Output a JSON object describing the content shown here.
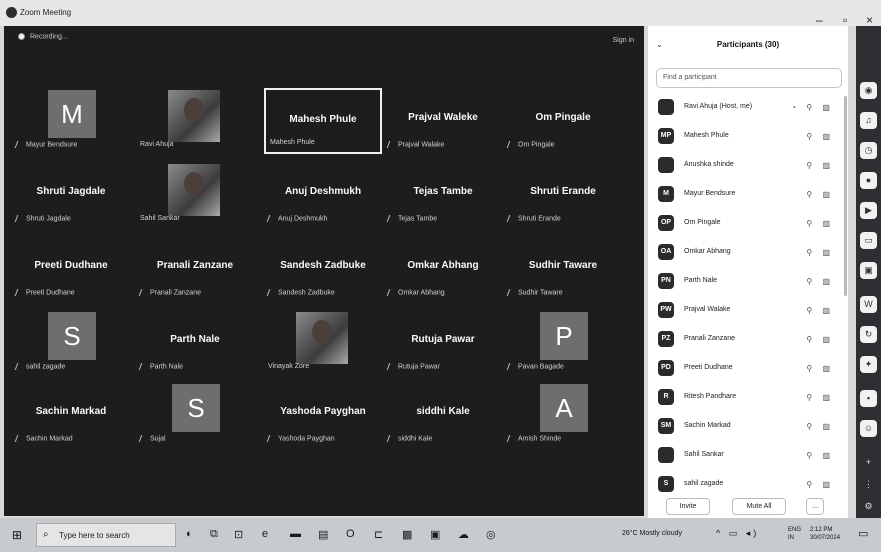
{
  "window": {
    "title": "Zoom Meeting",
    "min": "–",
    "max": "▫",
    "close": "×"
  },
  "stage": {
    "recording": "Recording...",
    "signin": "Sign in",
    "tiles": [
      {
        "name": "",
        "label": "Mayur Bendsure",
        "avatar": "M",
        "kind": "letter"
      },
      {
        "name": "",
        "label": "Ravi Ahuja",
        "avatar": "",
        "kind": "photo"
      },
      {
        "name": "Mahesh Phule",
        "label": "Mahesh Phule",
        "avatar": "",
        "kind": "name",
        "active": true
      },
      {
        "name": "Prajval Waleke",
        "label": "Prajval Walake",
        "avatar": "",
        "kind": "name"
      },
      {
        "name": "Om Pingale",
        "label": "Om Pingale",
        "avatar": "",
        "kind": "name"
      },
      {
        "name": "Shruti Jagdale",
        "label": "Shruti Jagdale",
        "avatar": "",
        "kind": "name"
      },
      {
        "name": "",
        "label": "Sahil Sankar",
        "avatar": "",
        "kind": "photo"
      },
      {
        "name": "Anuj Deshmukh",
        "label": "Anuj Deshmukh",
        "avatar": "",
        "kind": "name"
      },
      {
        "name": "Tejas Tambe",
        "label": "Tejas Tambe",
        "avatar": "",
        "kind": "name"
      },
      {
        "name": "Shruti Erande",
        "label": "Shruti Erande",
        "avatar": "",
        "kind": "name"
      },
      {
        "name": "Preeti Dudhane",
        "label": "Preeti Dudhane",
        "avatar": "",
        "kind": "name"
      },
      {
        "name": "Pranali Zanzane",
        "label": "Pranali Zanzane",
        "avatar": "",
        "kind": "name"
      },
      {
        "name": "Sandesh Zadbuke",
        "label": "Sandesh Zadbuke",
        "avatar": "",
        "kind": "name"
      },
      {
        "name": "Omkar Abhang",
        "label": "Omkar Abhang",
        "avatar": "",
        "kind": "name"
      },
      {
        "name": "Sudhir Taware",
        "label": "Sudhir Taware",
        "avatar": "",
        "kind": "name"
      },
      {
        "name": "",
        "label": "sahil zagade",
        "avatar": "S",
        "kind": "letter"
      },
      {
        "name": "Parth Nale",
        "label": "Parth Nale",
        "avatar": "",
        "kind": "name"
      },
      {
        "name": "",
        "label": "Vinayak Zore",
        "avatar": "",
        "kind": "photo"
      },
      {
        "name": "Rutuja Pawar",
        "label": "Rutuja Pawar",
        "avatar": "",
        "kind": "name"
      },
      {
        "name": "",
        "label": "Pavan Bagade",
        "avatar": "P",
        "kind": "letter"
      },
      {
        "name": "Sachin Markad",
        "label": "Sachin Markad",
        "avatar": "",
        "kind": "name"
      },
      {
        "name": "",
        "label": "Sujal",
        "avatar": "S",
        "kind": "letter"
      },
      {
        "name": "Yashoda Payghan",
        "label": "Yashoda Payghan",
        "avatar": "",
        "kind": "name"
      },
      {
        "name": "siddhi Kale",
        "label": "siddhi Kale",
        "avatar": "",
        "kind": "name"
      },
      {
        "name": "",
        "label": "Amish Shinde",
        "avatar": "A",
        "kind": "letter"
      }
    ]
  },
  "participants": {
    "title": "Participants (30)",
    "search_placeholder": "Find a participant",
    "list": [
      {
        "initials": "",
        "name": "Ravi Ahuja (Host, me)",
        "icons": "◔ ⚲ ▨"
      },
      {
        "initials": "MP",
        "name": "Mahesh Phule",
        "icons": "⚲ ▨"
      },
      {
        "initials": "",
        "name": "Anushka shinde",
        "icons": "⚲ ▨"
      },
      {
        "initials": "M",
        "name": "Mayur Bendsure",
        "icons": "⚲ ▨"
      },
      {
        "initials": "OP",
        "name": "Om Pingale",
        "icons": "⚲ ▨"
      },
      {
        "initials": "OA",
        "name": "Omkar Abhang",
        "icons": "⚲ ▨"
      },
      {
        "initials": "PN",
        "name": "Parth Nale",
        "icons": "⚲ ▨"
      },
      {
        "initials": "PW",
        "name": "Prajval Walake",
        "icons": "⚲ ▨"
      },
      {
        "initials": "PZ",
        "name": "Pranali Zanzane",
        "icons": "⚲ ▨"
      },
      {
        "initials": "PD",
        "name": "Preeti Dudhane",
        "icons": "⚲ ▨"
      },
      {
        "initials": "R",
        "name": "Ritesh Pandhare",
        "icons": "⚲ ▨"
      },
      {
        "initials": "SM",
        "name": "Sachin Markad",
        "icons": "⚲ ▨"
      },
      {
        "initials": "",
        "name": "Sahil Sankar",
        "icons": "⚲ ▨"
      },
      {
        "initials": "S",
        "name": "sahil zagade",
        "icons": "⚲ ▨"
      }
    ],
    "invite": "Invite",
    "mute_all": "Mute All",
    "more": "..."
  },
  "taskbar": {
    "search_placeholder": "Type here to search",
    "weather": "26°C  Mostly cloudy",
    "lang1": "ENG",
    "lang2": "IN",
    "time": "2:12 PM",
    "date": "30/07/2024"
  }
}
